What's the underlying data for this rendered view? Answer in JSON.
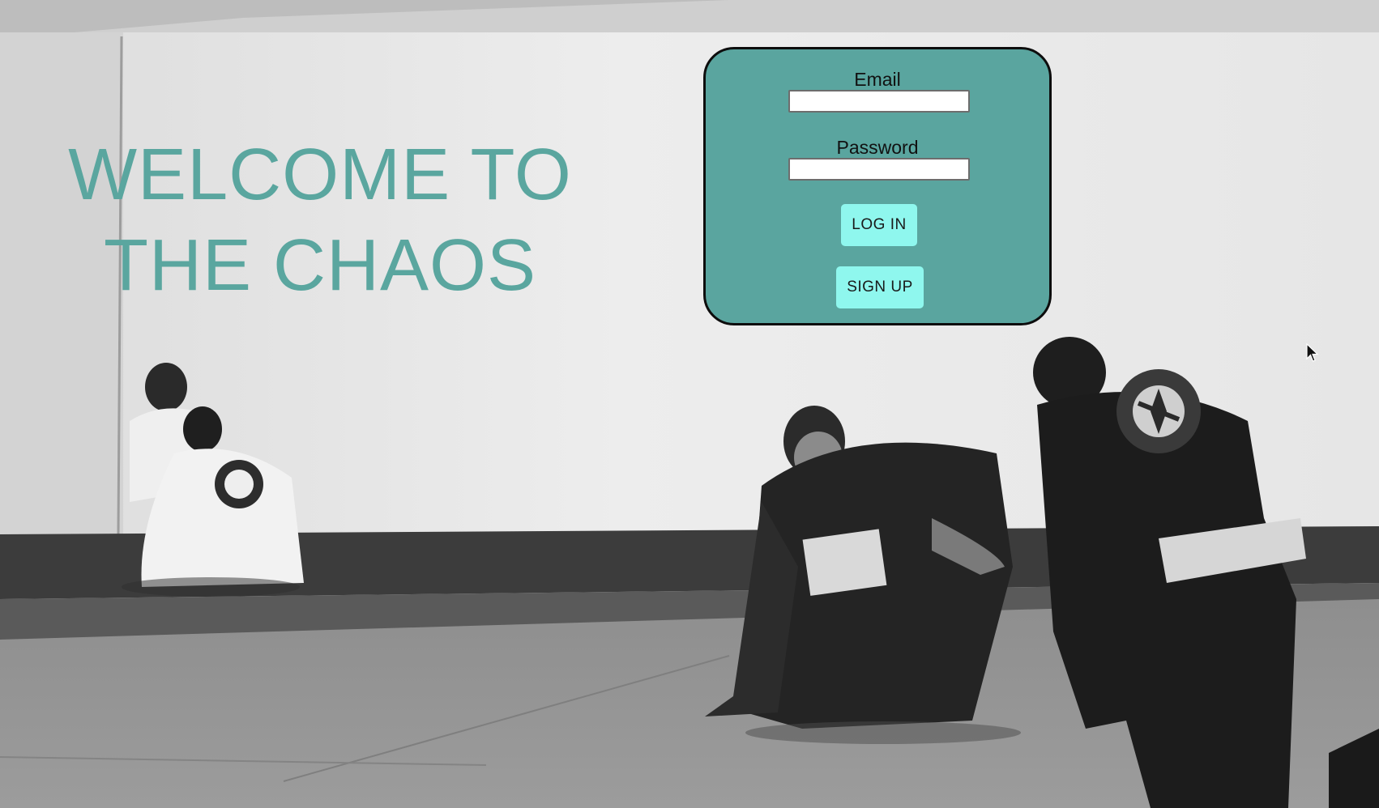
{
  "hero": {
    "line1": "WELCOME TO",
    "line2": "THE CHAOS"
  },
  "login": {
    "email_label": "Email",
    "email_value": "",
    "password_label": "Password",
    "password_value": "",
    "login_button": "LOG IN",
    "signup_button": "SIGN UP"
  },
  "colors": {
    "accent_teal": "#5aa59f",
    "button_cyan": "#8ff7ee",
    "card_border": "#0d0d0d"
  },
  "icons": {
    "cursor": "mouse-pointer-icon"
  }
}
